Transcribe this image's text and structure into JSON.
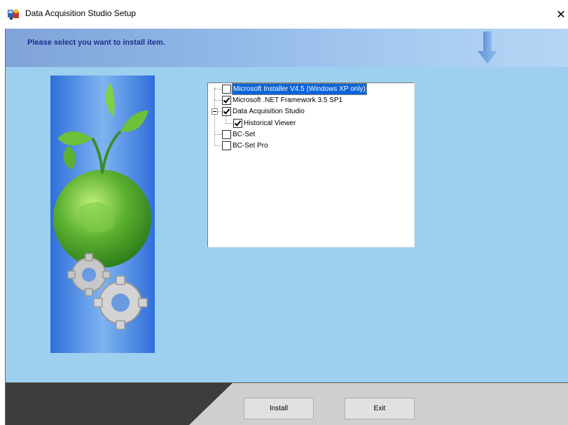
{
  "window": {
    "title": "Data Acquisition Studio Setup",
    "close_glyph": "✕"
  },
  "banner": {
    "instruction": "Please select you want to install item."
  },
  "tree": {
    "items": [
      {
        "label": "Microsoft Installer V4.5 (Windows XP only)",
        "checked": false,
        "selected": true
      },
      {
        "label": "Microsoft .NET Framework 3.5 SP1",
        "checked": true
      },
      {
        "label": "Data Acquisition Studio",
        "checked": true,
        "expanded": true
      },
      {
        "label": "Historical Viewer",
        "checked": true
      },
      {
        "label": "BC-Set",
        "checked": false
      },
      {
        "label": "BC-Set Pro",
        "checked": false
      }
    ]
  },
  "footer": {
    "install_label": "Install",
    "exit_label": "Exit"
  },
  "colors": {
    "banner_text": "#1b2f8f",
    "main_bg": "#9dd0ef",
    "selection": "#0a64d8"
  },
  "icons": [
    "app-setup-icon",
    "down-arrow-icon",
    "close-icon",
    "globe-with-sprout-and-gears-image"
  ]
}
